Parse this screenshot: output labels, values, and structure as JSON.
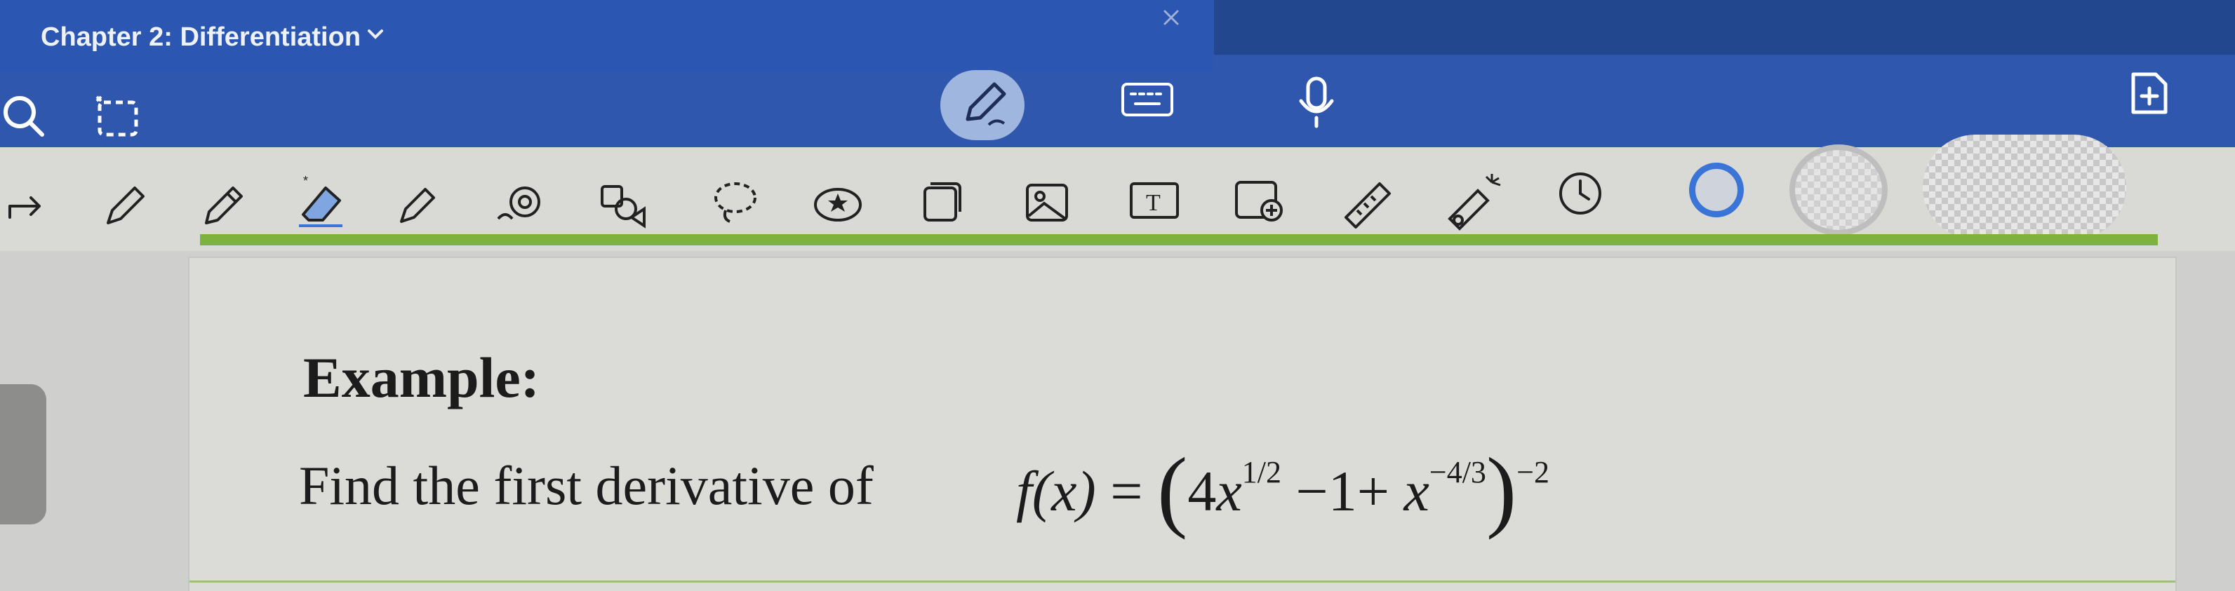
{
  "header": {
    "title": "Chapter 2: Differentiation"
  },
  "toolbar_top": {
    "icons": [
      "search-icon",
      "lasso-select-icon",
      "pencil-mode-icon",
      "keyboard-icon",
      "microphone-icon",
      "add-page-icon"
    ]
  },
  "toolbar_tools": {
    "icons": [
      "redo-icon",
      "pen-icon",
      "pencil-icon",
      "eraser-icon",
      "highlighter-icon",
      "shapes-icon",
      "elements-icon",
      "lasso-icon",
      "sticker-icon",
      "copy-icon",
      "image-icon",
      "text-box-icon",
      "image-search-icon",
      "ruler-icon",
      "laser-pointer-icon",
      "timer-icon"
    ]
  },
  "colors": {
    "top_bar": "#2f57ad",
    "accent_green": "#7db33c",
    "selected_color": "#3a74d6"
  },
  "page": {
    "heading": "Example:",
    "prompt": "Find the first derivative of",
    "formula": {
      "fx": "f(x)",
      "eq": "=",
      "open": "(",
      "term1_coef": "4",
      "term1_base": "x",
      "term1_exp": "1/2",
      "minus_one": "−1",
      "plus": "+",
      "term2_base": "x",
      "term2_exp": "−4/3",
      "close": ")",
      "outer_exp": "−2"
    }
  }
}
